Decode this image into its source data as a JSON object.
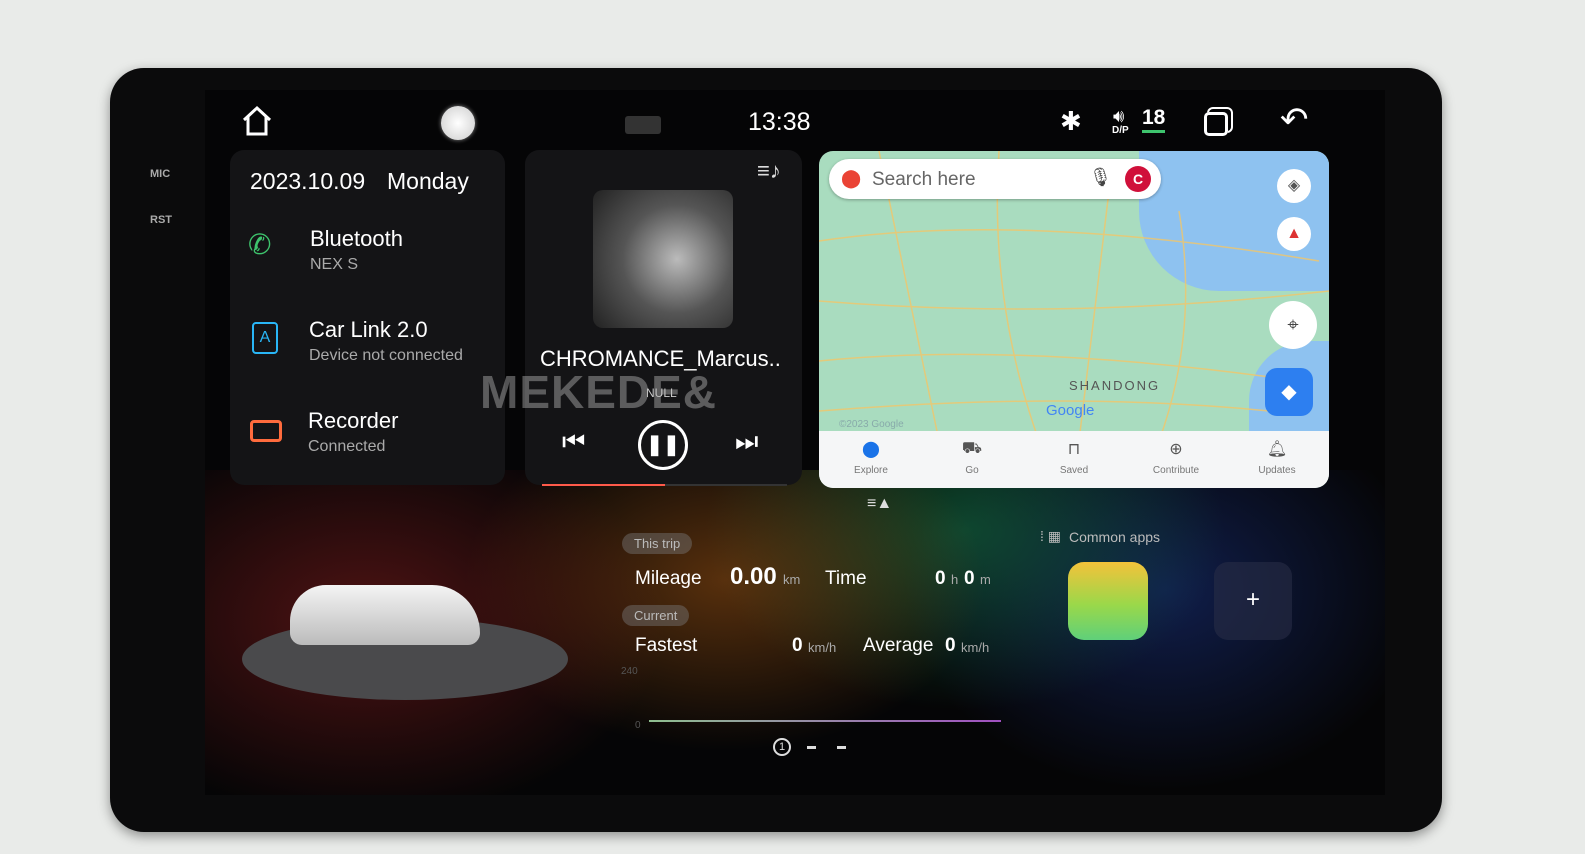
{
  "side_labels": {
    "mic": "MIC",
    "rst": "RST"
  },
  "status_bar": {
    "time": "13:38",
    "volume": "18",
    "audio_mode": "D/P",
    "icons": [
      "home-icon",
      "assistant-icon",
      "camera-icon",
      "bluetooth-icon",
      "volume-icon",
      "recent-apps-icon",
      "back-icon"
    ]
  },
  "info_card": {
    "date": "2023.10.09",
    "weekday": "Monday",
    "items": [
      {
        "title": "Bluetooth",
        "subtitle": "NEX S",
        "icon": "phone-icon",
        "color": "#3ec46d"
      },
      {
        "title": "Car Link 2.0",
        "subtitle": "Device not connected",
        "icon": "carlink-icon",
        "color": "#29b6f6"
      },
      {
        "title": "Recorder",
        "subtitle": "Connected",
        "icon": "recorder-icon",
        "color": "#ff6b3d"
      }
    ]
  },
  "music": {
    "title": "CHROMANCE_Marcus..",
    "artist": "NULL",
    "progress": 0.5,
    "accent": "#ff5a4a"
  },
  "watermark": "MEKEDE&",
  "map": {
    "search_placeholder": "Search here",
    "avatar_letter": "C",
    "region_label": "SHANDONG",
    "logo": "Google",
    "copyright": "©2023 Google",
    "nav": [
      {
        "label": "Explore",
        "icon": "pin-icon"
      },
      {
        "label": "Go",
        "icon": "commute-icon"
      },
      {
        "label": "Saved",
        "icon": "bookmark-icon"
      },
      {
        "label": "Contribute",
        "icon": "plus-circle-icon"
      },
      {
        "label": "Updates",
        "icon": "bell-icon"
      }
    ]
  },
  "trip": {
    "this_trip": "This trip",
    "mileage_label": "Mileage",
    "mileage": "0.00",
    "mileage_unit": "km",
    "time_label": "Time",
    "hours": "0",
    "h": "h",
    "minutes": "0",
    "m": "m",
    "current": "Current",
    "fastest_label": "Fastest",
    "fastest": "0",
    "speed_unit": "km/h",
    "average_label": "Average",
    "average": "0",
    "chart_max": "240",
    "chart_min": "0"
  },
  "pager": {
    "current": "1"
  },
  "common_apps": {
    "label": "Common apps",
    "add": "+"
  }
}
